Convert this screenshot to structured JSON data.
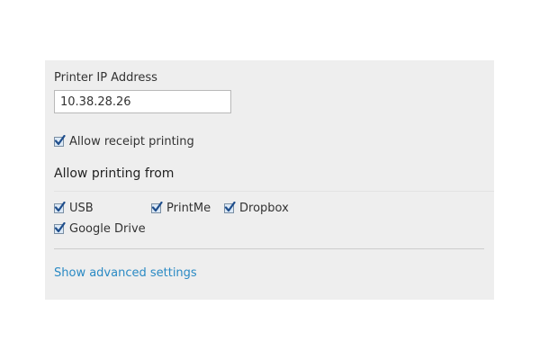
{
  "printer": {
    "ip_label": "Printer IP Address",
    "ip_value": "10.38.28.26"
  },
  "receipt": {
    "label": "Allow receipt printing",
    "checked": true
  },
  "sources": {
    "title": "Allow printing from",
    "items": [
      {
        "label": "USB",
        "checked": true
      },
      {
        "label": "PrintMe",
        "checked": true
      },
      {
        "label": "Dropbox",
        "checked": true
      },
      {
        "label": "Google Drive",
        "checked": true
      }
    ]
  },
  "advanced": {
    "link_label": "Show advanced settings"
  },
  "colors": {
    "panel_bg": "#eeeeee",
    "link": "#2a8ac4",
    "check": "#1f4e8c"
  },
  "icons": {
    "checkbox": "checkmark-icon"
  }
}
